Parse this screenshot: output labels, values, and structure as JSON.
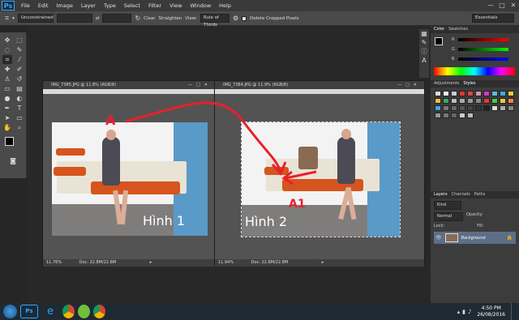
{
  "app": {
    "logo": "Ps",
    "accent": "#31a8ff"
  },
  "menu": [
    "File",
    "Edit",
    "Image",
    "Layer",
    "Type",
    "Select",
    "Filter",
    "View",
    "Window",
    "Help"
  ],
  "window_controls": [
    "—",
    "□",
    "✕"
  ],
  "options": {
    "mode": "Unconstrained",
    "clear_label": "Clear",
    "straighten_label": "Straighten",
    "view_label": "View:",
    "view_value": "Rule of Thirds",
    "delete_label": "Delete Cropped Pixels",
    "workspace": "Essentials"
  },
  "doc1": {
    "title": "IMG_7385.JPG @ 11.8% (RGB/8)",
    "zoom": "11.76%",
    "doc": "Doc: 22.8M/22.8M",
    "caption": "Hình 1",
    "marker": "A"
  },
  "doc2": {
    "title": "IMG_7384.JPG @ 11.9% (RGB/8)",
    "zoom": "11.94%",
    "doc": "Doc: 22.8M/22.8M",
    "caption": "Hình 2",
    "marker": "A1"
  },
  "color_panel": {
    "tabs": [
      "Color",
      "Swatches"
    ],
    "channels": [
      "R",
      "G",
      "B"
    ]
  },
  "styles_panel": {
    "tabs": [
      "Adjustments",
      "Styles"
    ]
  },
  "layers_panel": {
    "tabs": [
      "Layers",
      "Channels",
      "Paths"
    ],
    "kind": "Kind",
    "blend": "Normal",
    "opacity": "Opacity:",
    "lock": "Lock:",
    "fill": "Fill:",
    "layer_name": "Background"
  },
  "taskbar": {
    "time": "4:50 PM",
    "date": "26/08/2016"
  },
  "colors": {
    "fg": "#000000",
    "bg": "#e2501b",
    "arrow": "#e8202a"
  }
}
